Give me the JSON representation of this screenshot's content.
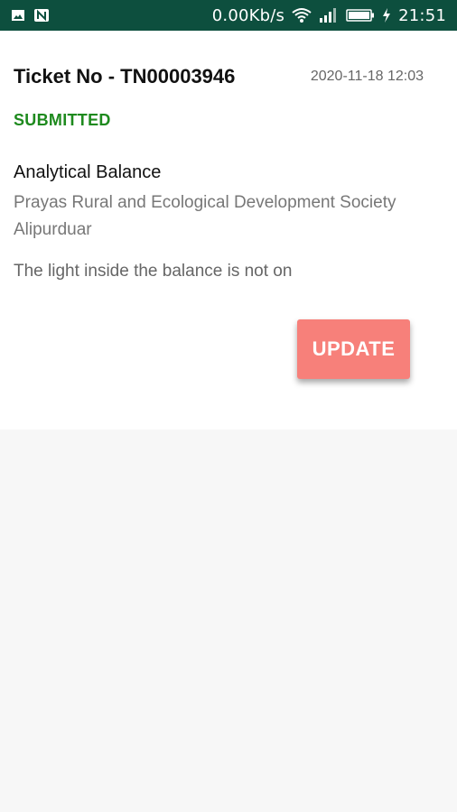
{
  "status_bar": {
    "network_speed": "0.00Kb/s",
    "time": "21:51",
    "icons": [
      "image-icon",
      "n-icon",
      "wifi-icon",
      "signal-icon",
      "battery-icon",
      "charging-icon"
    ]
  },
  "ticket": {
    "number": "Ticket No - TN00003946",
    "datetime": "2020-11-18 12:03",
    "status": "SUBMITTED",
    "product": "Analytical Balance",
    "organization": "Prayas Rural and Ecological Development Society Alipurduar",
    "issue": "The light inside the balance is not on"
  },
  "actions": {
    "update_label": "UPDATE"
  },
  "colors": {
    "status_bar_bg": "#0d4f3e",
    "status_text": "#1e8a1e",
    "update_button": "#f7807a",
    "page_bg": "#f7f7f7"
  }
}
